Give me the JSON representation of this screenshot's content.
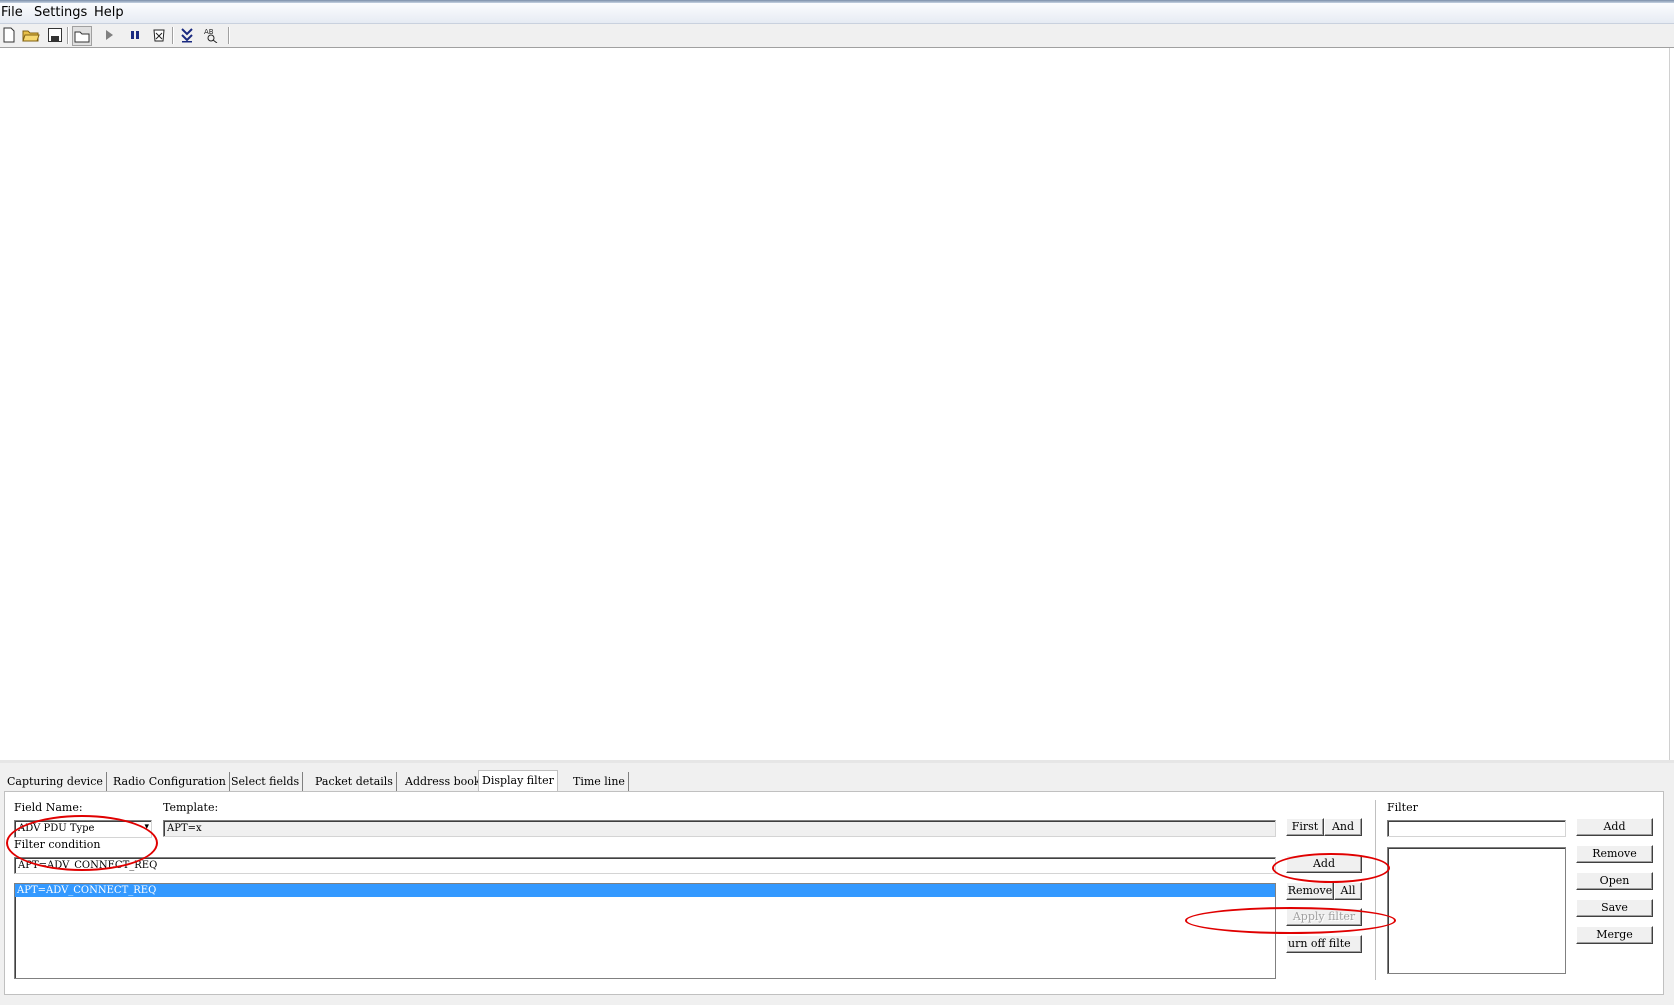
{
  "menu": {
    "items": [
      "File",
      "Settings",
      "Help"
    ]
  },
  "toolbar": {
    "icons": [
      "new-file-icon",
      "open-folder-icon",
      "save-icon",
      "folder-icon",
      "play-icon",
      "pause-icon",
      "clear-icon",
      "scroll-down-icon",
      "find-icon"
    ]
  },
  "tabs": [
    {
      "label": "Capturing device"
    },
    {
      "label": "Radio Configuration"
    },
    {
      "label": "Select fields"
    },
    {
      "label": "Packet details"
    },
    {
      "label": "Address book"
    },
    {
      "label": "Display filter"
    },
    {
      "label": "Time line"
    }
  ],
  "active_tab": "Display filter",
  "display_filter": {
    "field_name_label": "Field Name:",
    "field_name_value": "ADV PDU Type",
    "template_label": "Template:",
    "template_value": "APT=x",
    "filter_condition_label": "Filter condition",
    "filter_condition_value": "APT=ADV_CONNECT_REQ",
    "conditions": [
      "APT=ADV_CONNECT_REQ"
    ],
    "buttons": {
      "first": "First",
      "and": "And",
      "add": "Add",
      "remove": "Remove",
      "all": "All",
      "apply_filter": "Apply filter",
      "turn_off_filter": "urn off filte"
    }
  },
  "filter_panel": {
    "label": "Filter",
    "input_value": "",
    "buttons": {
      "add": "Add",
      "remove": "Remove",
      "open": "Open",
      "save": "Save",
      "merge": "Merge"
    }
  },
  "annotation_color": "#e00000",
  "selection_color": "#3399ff"
}
